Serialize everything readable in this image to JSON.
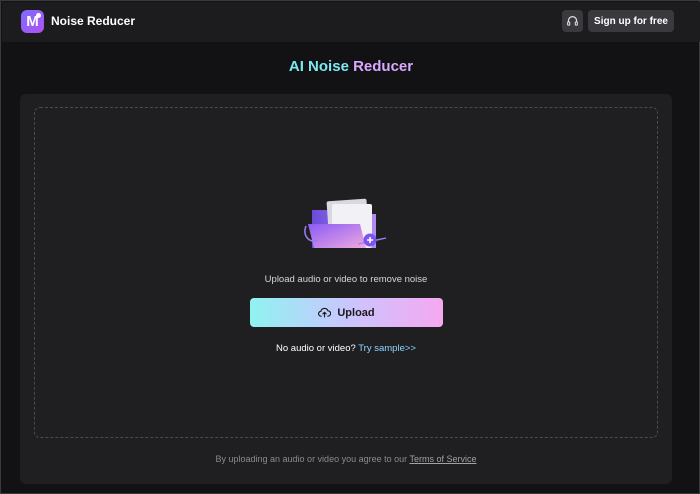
{
  "header": {
    "app_title": "Noise Reducer",
    "logo_letter": "M",
    "signup_label": "Sign up for free"
  },
  "page": {
    "title_part1": "AI Noise",
    "title_part2": "Reducer"
  },
  "upload": {
    "hint": "Upload audio or video to remove noise",
    "button_label": "Upload",
    "sample_question": "No audio or video?",
    "sample_link": "Try sample>>"
  },
  "footer": {
    "terms_prefix": "By uploading an audio or video you agree to our",
    "terms_link": "Terms of Service"
  },
  "colors": {
    "accent_cyan": "#7ce8f0",
    "accent_pink": "#d9a8ff",
    "link": "#8fd6ff"
  },
  "icons": {
    "logo": "app-logo-icon",
    "support": "headset-icon",
    "upload": "cloud-upload-icon",
    "illustration": "folder-plus-illustration"
  }
}
